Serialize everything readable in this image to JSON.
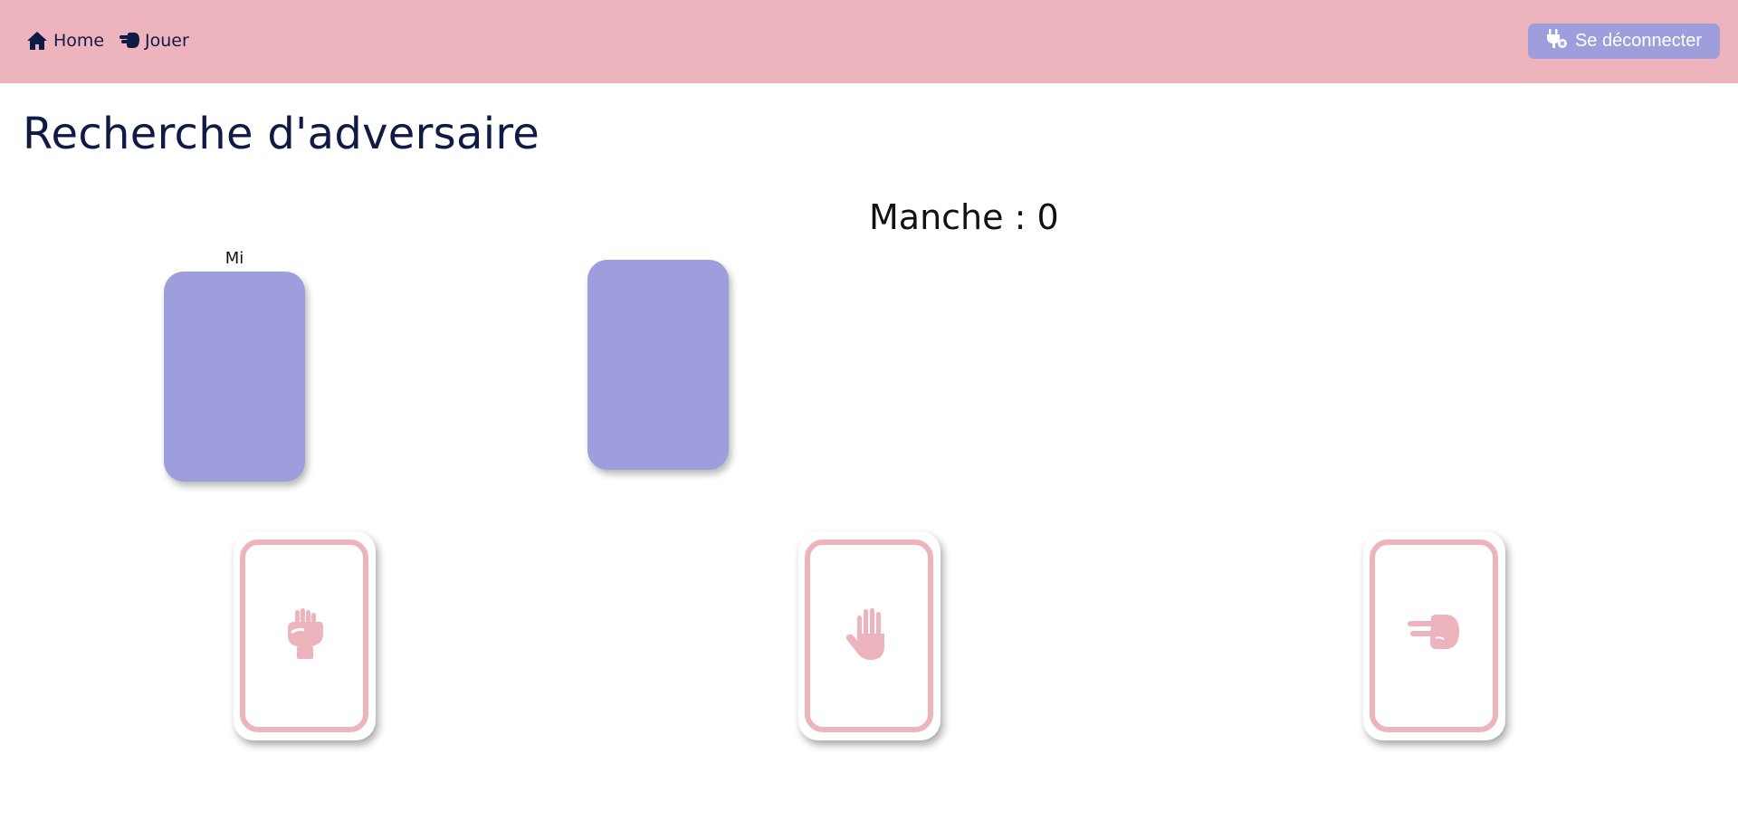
{
  "nav": {
    "home_label": "Home",
    "play_label": "Jouer",
    "logout_label": "Se déconnecter"
  },
  "main": {
    "title": "Recherche d'adversaire",
    "round_text": "Manche : 0",
    "player_name": "Mi"
  },
  "choices": [
    {
      "icon": "fist-rock-icon"
    },
    {
      "icon": "hand-paper-icon"
    },
    {
      "icon": "hand-scissors-icon"
    }
  ],
  "colors": {
    "navbar": "#eeb4bd",
    "accent": "#9e9edd",
    "text": "#0f1b45",
    "card_border": "#eeb4bd"
  }
}
